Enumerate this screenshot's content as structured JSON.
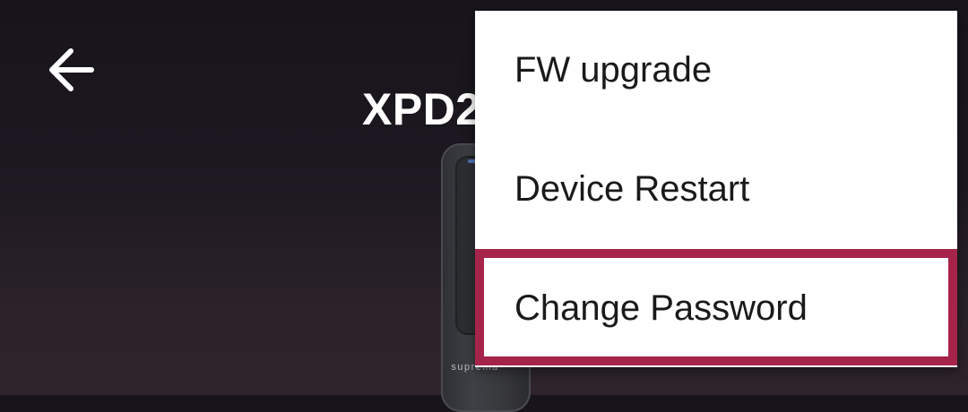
{
  "header": {
    "back_icon": "arrow-left-icon",
    "title": "XPD2"
  },
  "device": {
    "brand": "suprema"
  },
  "menu": {
    "items": [
      {
        "label": "FW upgrade"
      },
      {
        "label": "Device Restart"
      },
      {
        "label": "Change Password"
      }
    ],
    "highlighted_item": "Change Password",
    "highlight_color": "#a6234a"
  }
}
